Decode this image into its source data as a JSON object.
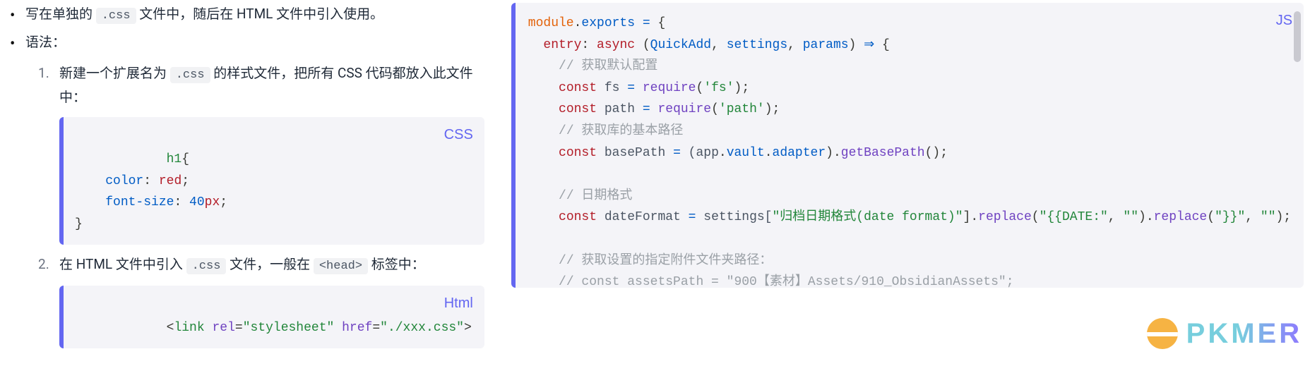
{
  "left": {
    "bullet1_a": "写在单独的 ",
    "bullet1_code": ".css",
    "bullet1_b": " 文件中，随后在 HTML 文件中引入使用。",
    "bullet2": "语法：",
    "step1_a": "新建一个扩展名为 ",
    "step1_code": ".css",
    "step1_b": " 的样式文件，把所有 CSS 代码都放入此文件中：",
    "code1_lang": "CSS",
    "code1": {
      "l1_sel": "h1",
      "l1_brace": "{",
      "l2_prop": "color",
      "l2_colon": ": ",
      "l2_val": "red",
      "l2_semi": ";",
      "l3_prop": "font-size",
      "l3_colon": ": ",
      "l3_num": "40",
      "l3_unit": "px",
      "l3_semi": ";",
      "l4_brace": "}"
    },
    "step2_a": "在 HTML 文件中引入 ",
    "step2_code1": ".css",
    "step2_b": " 文件，一般在 ",
    "step2_code2": "<head>",
    "step2_c": " 标签中：",
    "code2_lang": "Html",
    "code2": {
      "lt": "<",
      "tag": "link",
      "sp": " ",
      "attr1": "rel",
      "eq": "=",
      "val1": "\"stylesheet\"",
      "attr2": "href",
      "val2": "\"./xxx.css\"",
      "gt": ">"
    }
  },
  "right": {
    "lang": "JS",
    "l1_a": "module",
    "l1_b": ".",
    "l1_c": "exports",
    "l1_d": " ",
    "l1_e": "=",
    "l1_f": " {",
    "l2_a": "entry",
    "l2_b": ":",
    "l2_c": " ",
    "l2_d": "async",
    "l2_e": " (",
    "l2_f": "QuickAdd",
    "l2_g": ", ",
    "l2_h": "settings",
    "l2_i": ", ",
    "l2_j": "params",
    "l2_k": ") ",
    "l2_l": "⇒",
    "l2_m": " {",
    "l3": "// 获取默认配置",
    "l4_a": "const",
    "l4_b": " fs ",
    "l4_c": "=",
    "l4_d": " ",
    "l4_e": "require",
    "l4_f": "(",
    "l4_g": "'fs'",
    "l4_h": ");",
    "l5_a": "const",
    "l5_b": " path ",
    "l5_c": "=",
    "l5_d": " ",
    "l5_e": "require",
    "l5_f": "(",
    "l5_g": "'path'",
    "l5_h": ");",
    "l6": "// 获取库的基本路径",
    "l7_a": "const",
    "l7_b": " basePath ",
    "l7_c": "=",
    "l7_d": " (app",
    "l7_e": ".",
    "l7_f": "vault",
    "l7_g": ".",
    "l7_h": "adapter",
    "l7_i": ").",
    "l7_j": "getBasePath",
    "l7_k": "();",
    "l8": "",
    "l9": "// 日期格式",
    "l10_a": "const",
    "l10_b": " dateFormat ",
    "l10_c": "=",
    "l10_d": " settings[",
    "l10_e": "\"归档日期格式(date format)\"",
    "l10_f": "].",
    "l10_g": "replace",
    "l10_h": "(",
    "l10_i": "\"{{DATE:\"",
    "l10_j": ", ",
    "l10_k": "\"\"",
    "l10_l": ").",
    "l10_m": "replace",
    "l10_n": "(",
    "l10_o": "\"}}\"",
    "l10_p": ", ",
    "l10_q": "\"\"",
    "l10_r": ");",
    "l11": "",
    "l12": "// 获取设置的指定附件文件夹路径：",
    "l13": "// const assetsPath = \"900【素材】Assets/910_ObsidianAssets\";"
  },
  "watermark": "PKMER"
}
